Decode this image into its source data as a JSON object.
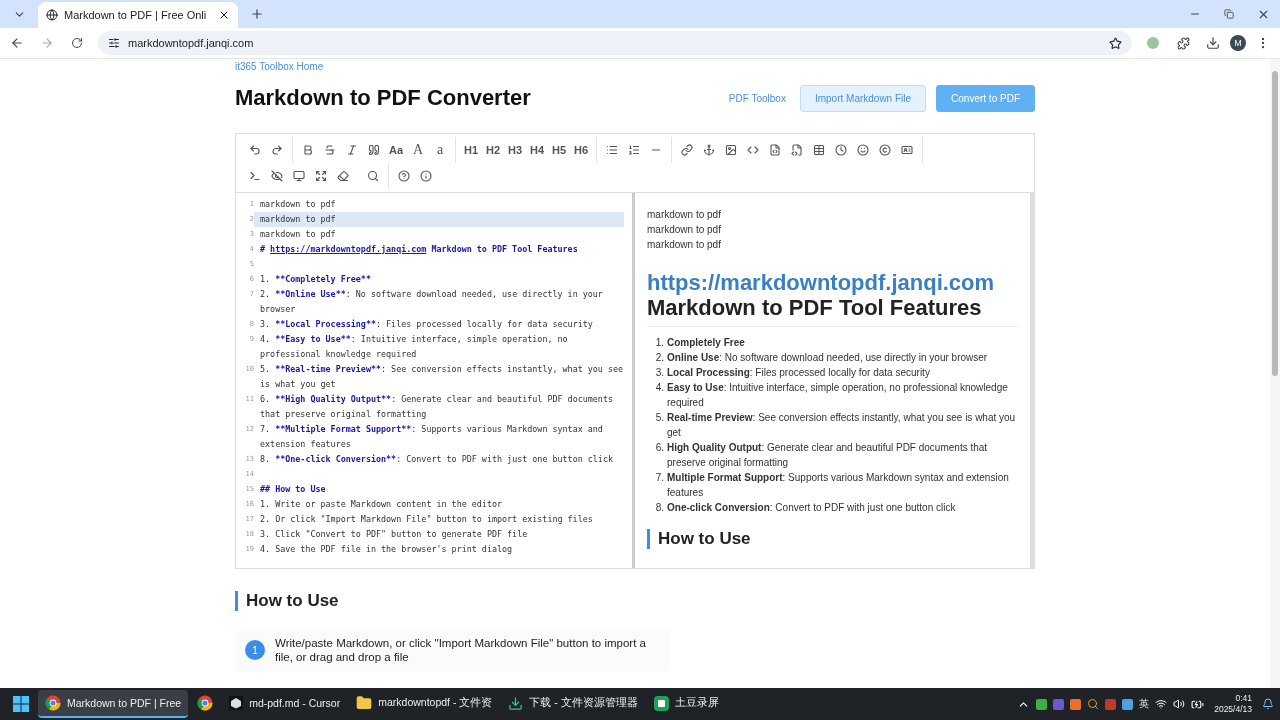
{
  "browser": {
    "tabs": [
      {
        "title": "Markdown to PDF | Free Onli",
        "selected": true
      }
    ],
    "url": "markdowntopdf.janqi.com",
    "profile": "M"
  },
  "page": {
    "home_link": "it365 Toolbox Home",
    "title": "Markdown to PDF Converter",
    "toolbox_link": "PDF Toolbox",
    "import_button": "Import Markdown File",
    "convert_button": "Convert to PDF",
    "toolbar": {
      "text_buttons": [
        "Aa",
        "A",
        "a",
        "H1",
        "H2",
        "H3",
        "H4",
        "H5",
        "H6"
      ]
    },
    "editor": {
      "lines": [
        {
          "number": "1",
          "active": false,
          "segments": [
            {
              "kind": "plain",
              "text": "markdown to pdf"
            }
          ]
        },
        {
          "number": "2",
          "active": true,
          "segments": [
            {
              "kind": "plain",
              "text": "markdown to pdf"
            }
          ]
        },
        {
          "number": "3",
          "active": false,
          "segments": [
            {
              "kind": "plain",
              "text": "markdown to pdf"
            }
          ]
        },
        {
          "number": "4",
          "active": false,
          "segments": [
            {
              "kind": "header",
              "text": "# "
            },
            {
              "kind": "link",
              "text": "https://markdowntopdf.janqi.com"
            },
            {
              "kind": "header",
              "text": " Markdown to PDF Tool Features"
            }
          ]
        },
        {
          "number": "5",
          "active": false
        },
        {
          "number": "6",
          "active": false,
          "segments": [
            {
              "kind": "plain",
              "text": "1. "
            },
            {
              "kind": "strong",
              "text": "**Completely Free**"
            }
          ]
        },
        {
          "number": "7",
          "active": false,
          "segments": [
            {
              "kind": "plain",
              "text": "2. "
            },
            {
              "kind": "strong",
              "text": "**Online Use**"
            },
            {
              "kind": "plain",
              "text": ": No software download needed, use directly in your browser"
            }
          ]
        },
        {
          "number": "8",
          "active": false,
          "segments": [
            {
              "kind": "plain",
              "text": "3. "
            },
            {
              "kind": "strong",
              "text": "**Local Processing**"
            },
            {
              "kind": "plain",
              "text": ": Files processed locally for data security"
            }
          ]
        },
        {
          "number": "9",
          "active": false,
          "segments": [
            {
              "kind": "plain",
              "text": "4. "
            },
            {
              "kind": "strong",
              "text": "**Easy to Use**"
            },
            {
              "kind": "plain",
              "text": ": Intuitive interface, simple operation, no professional knowledge required"
            }
          ]
        },
        {
          "number": "10",
          "active": false,
          "segments": [
            {
              "kind": "plain",
              "text": "5. "
            },
            {
              "kind": "strong",
              "text": "**Real-time Preview**"
            },
            {
              "kind": "plain",
              "text": ": See conversion effects instantly, what you see is what you get"
            }
          ]
        },
        {
          "number": "11",
          "active": false,
          "segments": [
            {
              "kind": "plain",
              "text": "6. "
            },
            {
              "kind": "strong",
              "text": "**High Quality Output**"
            },
            {
              "kind": "plain",
              "text": ": Generate clear and beautiful PDF documents that preserve original formatting"
            }
          ]
        },
        {
          "number": "12",
          "active": false,
          "segments": [
            {
              "kind": "plain",
              "text": "7. "
            },
            {
              "kind": "strong",
              "text": "**Multiple Format Support**"
            },
            {
              "kind": "plain",
              "text": ": Supports various Markdown syntax and extension features"
            }
          ]
        },
        {
          "number": "13",
          "active": false,
          "segments": [
            {
              "kind": "plain",
              "text": "8. "
            },
            {
              "kind": "strong",
              "text": "**One-click Conversion**"
            },
            {
              "kind": "plain",
              "text": ": Convert to PDF with just one button click"
            }
          ]
        },
        {
          "number": "14",
          "active": false
        },
        {
          "number": "15",
          "active": false,
          "segments": [
            {
              "kind": "header",
              "text": "## How to Use"
            }
          ]
        },
        {
          "number": "16",
          "active": false,
          "segments": [
            {
              "kind": "plain",
              "text": "1. Write or paste Markdown content in the editor"
            }
          ]
        },
        {
          "number": "17",
          "active": false,
          "segments": [
            {
              "kind": "plain",
              "text": "2. Or click \"Import Markdown File\" button to import existing files"
            }
          ]
        },
        {
          "number": "18",
          "active": false,
          "segments": [
            {
              "kind": "plain",
              "text": "3. Click \"Convert to PDF\" button to generate PDF file"
            }
          ]
        },
        {
          "number": "19",
          "active": false,
          "segments": [
            {
              "kind": "plain",
              "text": "4. Save the PDF file in the browser's print dialog"
            }
          ]
        }
      ]
    },
    "preview": {
      "paragraphs": [
        "markdown to pdf",
        "markdown to pdf",
        "markdown to pdf"
      ],
      "heading_link": "https://markdowntopdf.janqi.com",
      "heading_text": "Markdown to PDF Tool Features",
      "items": [
        {
          "number": "1.",
          "text": "**Completely Free**"
        },
        {
          "number": "2.",
          "text": "**Online Use**: No software download needed, use directly in your browser"
        },
        {
          "number": "3.",
          "text": "**Local Processing**: Files processed locally for data security"
        },
        {
          "number": "4.",
          "text": "**Easy to Use**: Intuitive interface, simple operation, no professional knowledge required"
        },
        {
          "number": "5.",
          "text": "**Real-time Preview**: See conversion effects instantly, what you see is what you get"
        },
        {
          "number": "6.",
          "text": "**High Quality Output**: Generate clear and beautiful PDF documents that preserve original formatting"
        },
        {
          "number": "7.",
          "text": "**Multiple Format Support**: Supports various Markdown syntax and extension features"
        },
        {
          "number": "8.",
          "text": "**One-click Conversion**: Convert to PDF with just one button click"
        }
      ],
      "subheading": "How to Use"
    },
    "how_to": {
      "title": "How to Use",
      "steps": [
        {
          "number": "1",
          "text": "Write/paste Markdown, or click \"Import Markdown File\" button to import a file, or drag and drop a file"
        }
      ]
    }
  },
  "taskbar": {
    "items": [
      {
        "kind": "chrome",
        "label": "Markdown to PDF | Free",
        "selected": true
      },
      {
        "kind": "chrome",
        "selected": false
      },
      {
        "kind": "cursor",
        "label": "md-pdf.md - Cursor",
        "selected": false
      },
      {
        "kind": "folder",
        "label": "markdowntopdf - 文件资",
        "selected": false
      },
      {
        "kind": "download",
        "label": "下载 - 文件资源管理器",
        "selected": false
      },
      {
        "kind": "app",
        "label": "土豆录屏",
        "selected": false
      }
    ],
    "input_method": "英",
    "time": "0:41",
    "date": "2025/4/13"
  }
}
